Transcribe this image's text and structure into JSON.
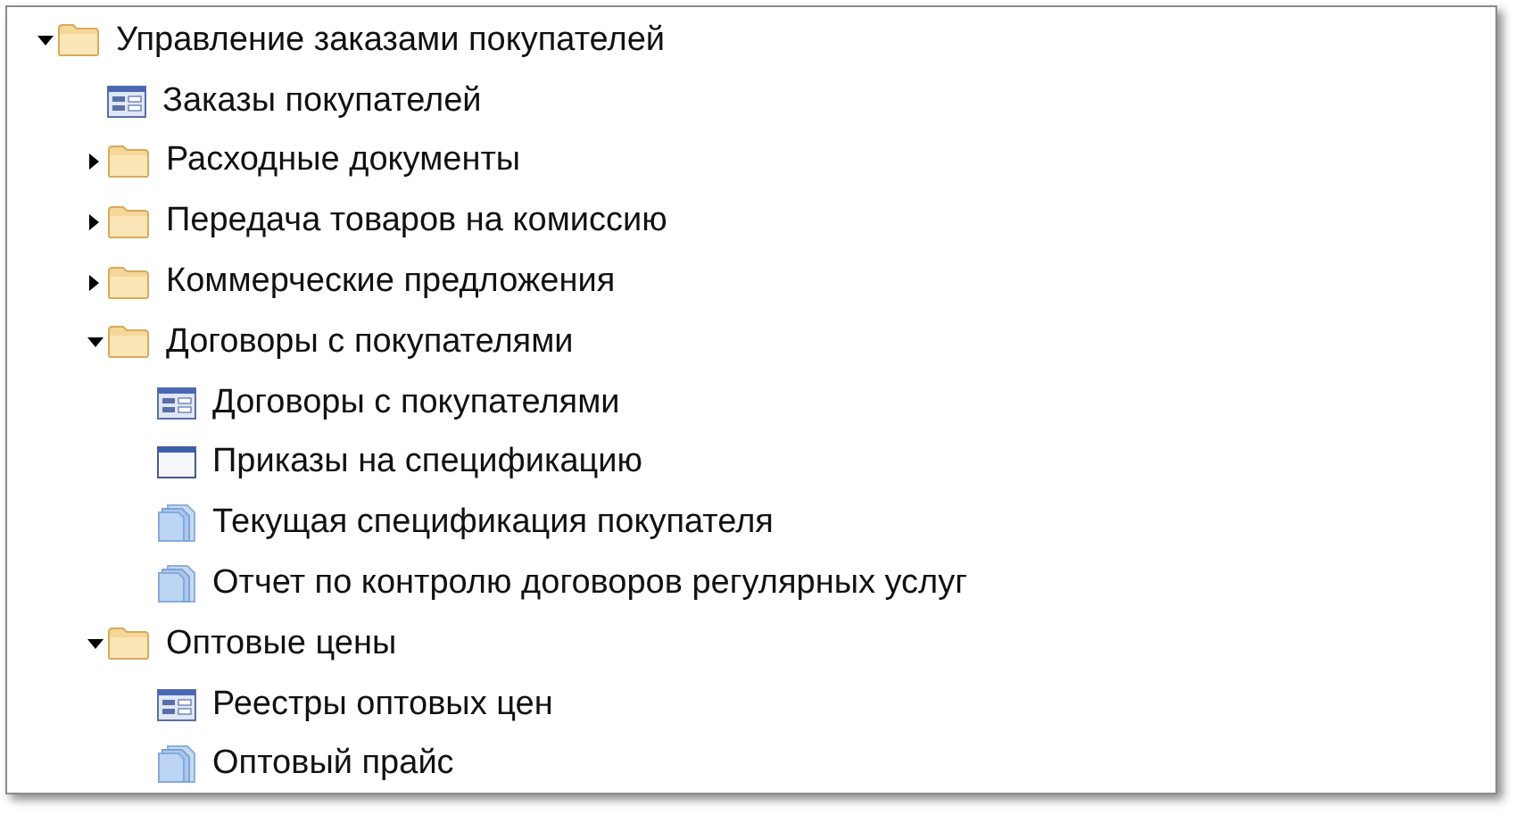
{
  "tree": [
    {
      "kind": "folder",
      "label": "Управление заказами покупателей",
      "expanded": true,
      "children": [
        {
          "kind": "journal",
          "label": "Заказы покупателей"
        },
        {
          "kind": "folder",
          "label": "Расходные документы",
          "expanded": false
        },
        {
          "kind": "folder",
          "label": "Передача товаров на комиссию",
          "expanded": false
        },
        {
          "kind": "folder",
          "label": "Коммерческие предложения",
          "expanded": false
        },
        {
          "kind": "folder",
          "label": "Договоры с покупателями",
          "expanded": true,
          "children": [
            {
              "kind": "journal",
              "label": "Договоры с покупателями"
            },
            {
              "kind": "form",
              "label": "Приказы на спецификацию"
            },
            {
              "kind": "report",
              "label": "Текущая спецификация покупателя"
            },
            {
              "kind": "report",
              "label": "Отчет по контролю договоров регулярных услуг"
            }
          ]
        },
        {
          "kind": "folder",
          "label": "Оптовые цены",
          "expanded": true,
          "children": [
            {
              "kind": "journal",
              "label": "Реестры оптовых цен"
            },
            {
              "kind": "report",
              "label": "Оптовый прайс"
            }
          ]
        }
      ]
    }
  ]
}
